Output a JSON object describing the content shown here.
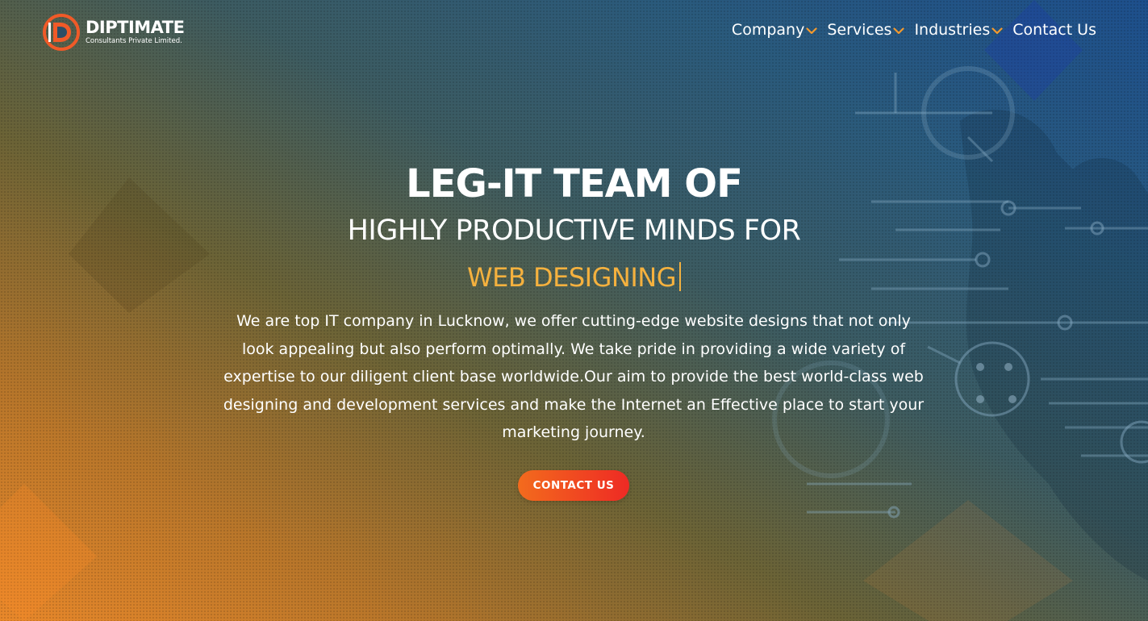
{
  "brand": {
    "name": "DIPTIMATE",
    "tagline": "Consultants Private Limited.",
    "logo_icon": "d-logo-icon",
    "accent_color": "#f05a28"
  },
  "nav": {
    "items": [
      {
        "label": "Company",
        "icon": "chevron-down-icon"
      },
      {
        "label": "Services",
        "icon": "chevron-down-icon"
      },
      {
        "label": "Industries",
        "icon": "chevron-down-icon"
      },
      {
        "label": "Contact Us"
      }
    ],
    "chevron_color": "#f39a2e"
  },
  "hero": {
    "headline": "LEG-IT TEAM OF",
    "subheadline": "HIGHLY PRODUCTIVE MINDS FOR",
    "typed_text": "WEB DESIGNING",
    "typed_text_color": "#f5b13e",
    "description": "We are top IT company in Lucknow, we offer cutting-edge website designs that not only look appealing but also perform optimally. We take pride in providing a wide variety of expertise to our diligent client base worldwide.Our aim to provide the best world-class web designing and development services and make the Internet an Effective place to start your marketing journey.",
    "cta_label": "CONTACT US"
  }
}
